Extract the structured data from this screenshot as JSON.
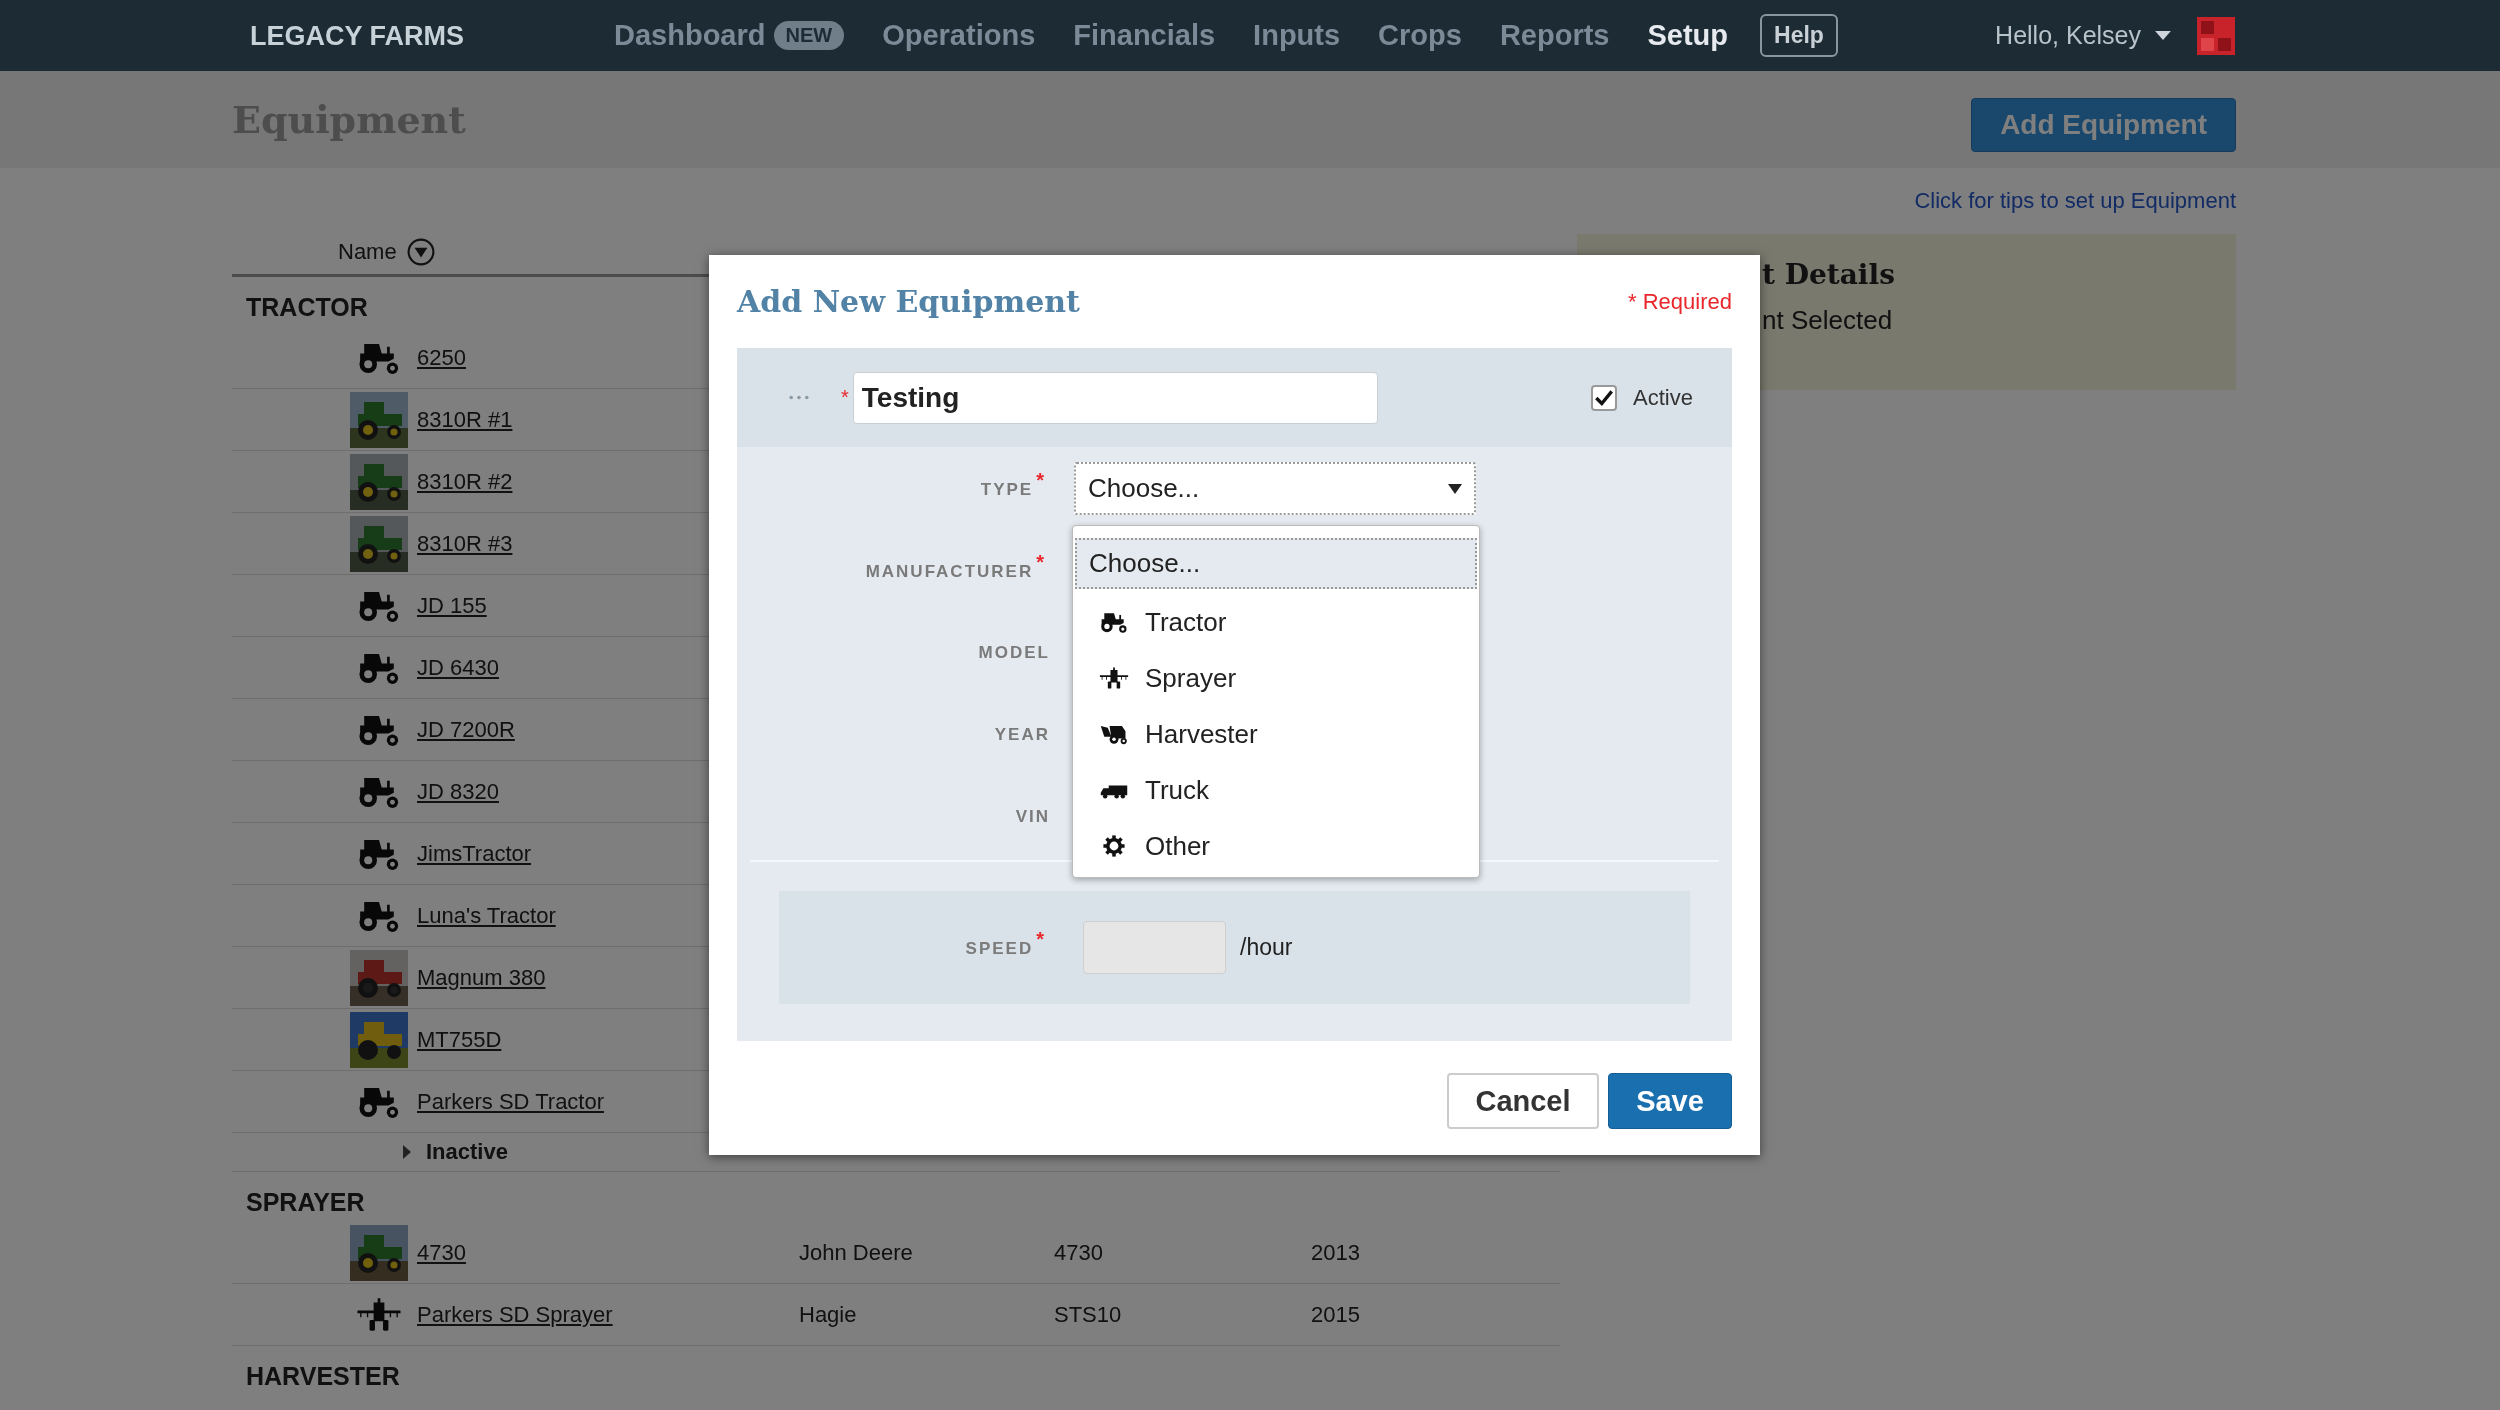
{
  "nav": {
    "brand": "LEGACY FARMS",
    "items": [
      {
        "label": "Dashboard",
        "badge": "NEW",
        "selected": false
      },
      {
        "label": "Operations",
        "selected": false
      },
      {
        "label": "Financials",
        "selected": false
      },
      {
        "label": "Inputs",
        "selected": false
      },
      {
        "label": "Crops",
        "selected": false
      },
      {
        "label": "Reports",
        "selected": false
      },
      {
        "label": "Setup",
        "selected": true
      }
    ],
    "help": "Help",
    "user": "Hello, Kelsey"
  },
  "page": {
    "title": "Equipment",
    "add_button": "Add Equipment",
    "tips_link": "Click for tips to set up Equipment",
    "details": {
      "title": "t Details",
      "text": "nt Selected"
    }
  },
  "list": {
    "name_header": "Name",
    "groups": [
      {
        "name": "TRACTOR",
        "kind": "tractor",
        "rows": [
          {
            "name": "6250",
            "kind": "icon"
          },
          {
            "name": "8310R #1",
            "kind": "picture"
          },
          {
            "name": "8310R #2",
            "kind": "picture"
          },
          {
            "name": "8310R #3",
            "kind": "picture"
          },
          {
            "name": "JD 155",
            "kind": "icon"
          },
          {
            "name": "JD 6430",
            "kind": "icon"
          },
          {
            "name": "JD 7200R",
            "kind": "icon"
          },
          {
            "name": "JD 8320",
            "kind": "icon"
          },
          {
            "name": "JimsTractor",
            "kind": "icon"
          },
          {
            "name": "Luna's Tractor",
            "kind": "icon"
          },
          {
            "name": "Magnum 380",
            "kind": "picture"
          },
          {
            "name": "MT755D",
            "kind": "picture"
          },
          {
            "name": "Parkers SD Tractor",
            "kind": "icon"
          }
        ],
        "inactive": {
          "label": "Inactive",
          "expanded": false
        }
      },
      {
        "name": "SPRAYER",
        "kind": "sprayer",
        "rows": [
          {
            "name": "4730",
            "kind": "picture",
            "manufacturer": "John Deere",
            "model": "4730",
            "year": "2013"
          },
          {
            "name": "Parkers SD Sprayer",
            "kind": "icon",
            "manufacturer": "Hagie",
            "model": "STS10",
            "year": "2015"
          }
        ]
      },
      {
        "name": "HARVESTER"
      }
    ]
  },
  "modal": {
    "title": "Add New Equipment",
    "required_note": "* Required",
    "name_field": {
      "required_mark": "*",
      "value": "Testing"
    },
    "active": {
      "label": "Active",
      "checked": true
    },
    "fields": [
      {
        "label": "TYPE",
        "required_mark": "*",
        "kind": "select",
        "value": "Choose..."
      },
      {
        "label": "MANUFACTURER",
        "required_mark": "*"
      },
      {
        "label": "MODEL"
      },
      {
        "label": "YEAR"
      },
      {
        "label": "VIN"
      }
    ],
    "dropdown": [
      {
        "label": "Choose...",
        "kind": "none",
        "selected": true
      },
      {
        "label": "Tractor",
        "kind": "tractor",
        "selected": false
      },
      {
        "label": "Sprayer",
        "kind": "sprayer",
        "selected": false
      },
      {
        "label": "Harvester",
        "kind": "harvester",
        "selected": false
      },
      {
        "label": "Truck",
        "kind": "truck",
        "selected": false
      },
      {
        "label": "Other",
        "kind": "other",
        "selected": false
      }
    ],
    "speed": {
      "label": "SPEED",
      "required_mark": "*",
      "unit": "/hour"
    },
    "buttons": {
      "cancel": "Cancel",
      "save": "Save"
    }
  }
}
